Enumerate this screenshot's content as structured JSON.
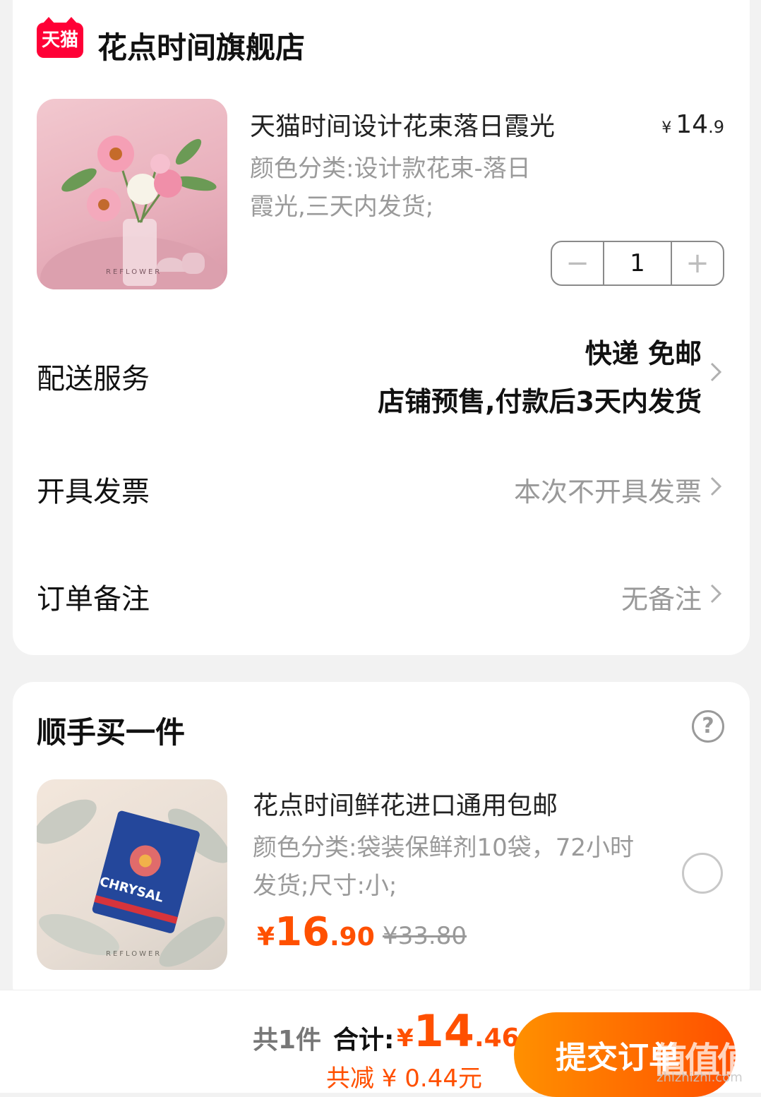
{
  "store": {
    "logo_text": "天猫",
    "name": "花点时间旗舰店"
  },
  "product": {
    "title": "天猫时间设计花束落日霞光",
    "price_currency": "¥",
    "price_int": "14",
    "price_dec": ".9",
    "sku_text": "颜色分类:设计款花束-落日霞光,三天内发货;",
    "image_caption": "REFLOWER",
    "quantity": "1",
    "minus_symbol": "−",
    "plus_symbol": "+"
  },
  "delivery": {
    "label": "配送服务",
    "line1": "快递 免邮",
    "line2": "店铺预售,付款后3天内发货"
  },
  "invoice": {
    "label": "开具发票",
    "value": "本次不开具发票"
  },
  "note": {
    "label": "订单备注",
    "value": "无备注"
  },
  "addon": {
    "section_title": "顺手买一件",
    "help_symbol": "?",
    "title": "花点时间鲜花进口通用包邮",
    "sku_text": "颜色分类:袋装保鲜剂10袋，72小时发货;尺寸:小;",
    "package_text": "CHRYSAL",
    "image_caption": "REFLOWER",
    "price_currency": "¥",
    "price_int": "16",
    "price_dec": ".90",
    "original_price": "¥33.80"
  },
  "footer": {
    "count_text": "共1件",
    "total_label": "合计:",
    "total_currency": "¥",
    "total_int": "14",
    "total_dec": ".46",
    "saving_text": "共减 ¥ 0.44元",
    "submit_label": "提交订单",
    "watermark": "值值值",
    "watermark_url": "zhizhizhi.com"
  },
  "colors": {
    "accent": "#ff5000",
    "tmall_red": "#ff0036"
  },
  "icons": {
    "chevron": "chevron-right-icon",
    "help": "help-circle-icon",
    "radio": "radio-unchecked-icon"
  }
}
